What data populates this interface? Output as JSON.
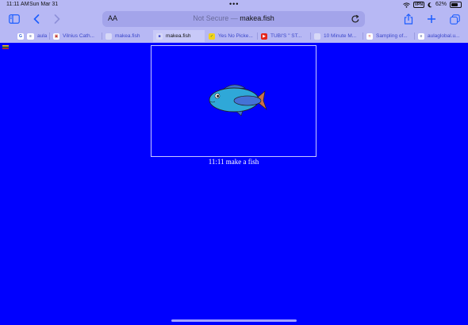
{
  "status_bar": {
    "time": "11:11 AM",
    "date": "Sun Mar 31",
    "battery": "62%",
    "vpn": "VPN",
    "battery_level": 0.62
  },
  "address_bar": {
    "text_size_label": "AA",
    "security_label": "Not Secure —",
    "domain": "makea.fish"
  },
  "tabs": [
    {
      "label": "aula",
      "favicon": "aula-favicon"
    },
    {
      "label": "Vilnius Cath...",
      "favicon": "cathedral-favicon"
    },
    {
      "label": "makea.fish",
      "favicon": "generic-page-favicon"
    },
    {
      "label": "makea.fish",
      "favicon": "generic-page-favicon",
      "active": true
    },
    {
      "label": "Yes No Picke...",
      "favicon": "picker-favicon"
    },
    {
      "label": "TUBI'S \" ST...",
      "favicon": "youtube-favicon"
    },
    {
      "label": "10 Minute M...",
      "favicon": "generic-page-favicon"
    },
    {
      "label": "Sampling of...",
      "favicon": "sampling-favicon"
    },
    {
      "label": "aulaglobal.u...",
      "favicon": "aula-favicon"
    }
  ],
  "page": {
    "caption": "11:11 make a fish"
  },
  "colors": {
    "page_bg": "#0000ff",
    "chrome_bg": "#b7b8f4",
    "accent": "#1a5cff"
  }
}
